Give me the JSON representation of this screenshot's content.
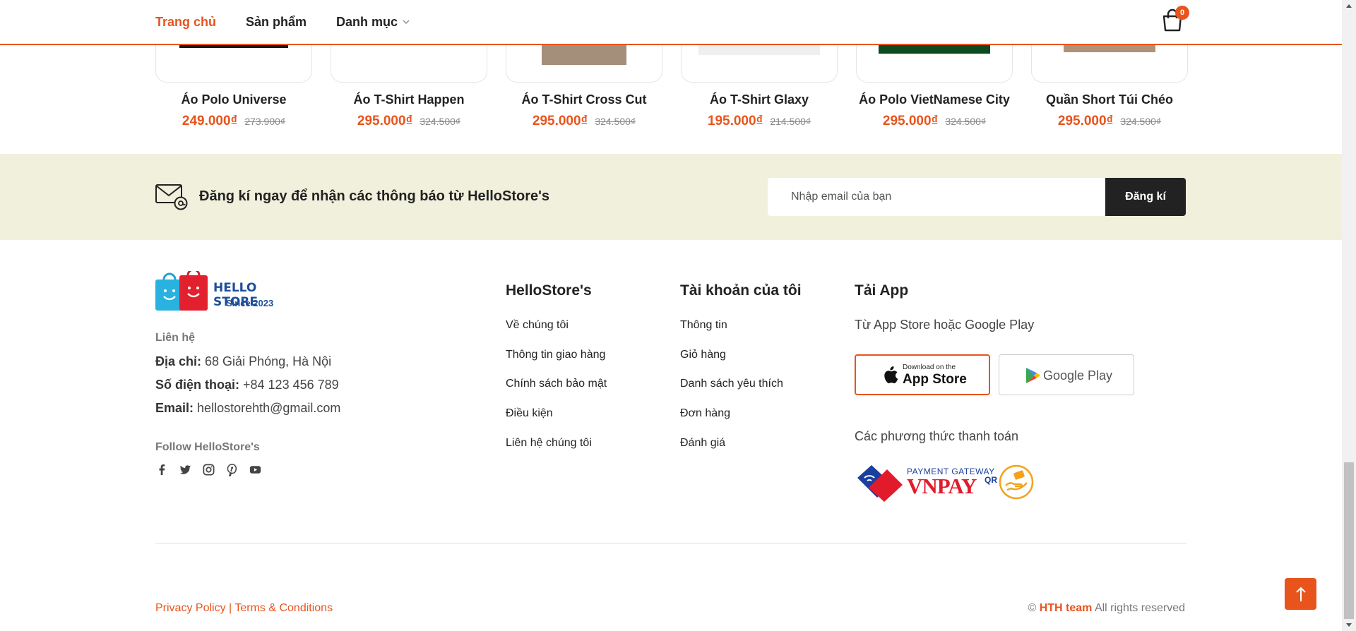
{
  "header": {
    "nav": [
      "Trang chủ",
      "Sản phẩm",
      "Danh mục"
    ],
    "cart_count": "0"
  },
  "products": [
    {
      "name": "Áo Polo Universe",
      "price": "249.000₫",
      "old_price": "273.900₫"
    },
    {
      "name": "Áo T-Shirt Happen",
      "price": "295.000₫",
      "old_price": "324.500₫"
    },
    {
      "name": "Áo T-Shirt Cross Cut",
      "price": "295.000₫",
      "old_price": "324.500₫"
    },
    {
      "name": "Áo T-Shirt Glaxy",
      "price": "195.000₫",
      "old_price": "214.500₫"
    },
    {
      "name": "Áo Polo VietNamese City",
      "price": "295.000₫",
      "old_price": "324.500₫"
    },
    {
      "name": "Quần Short Túi Chéo",
      "price": "295.000₫",
      "old_price": "324.500₫"
    }
  ],
  "newsletter": {
    "text": "Đăng kí ngay để nhận các thông báo từ HelloStore's",
    "placeholder": "Nhập email của bạn",
    "button": "Đăng kí"
  },
  "footer": {
    "logo_line1": "HELLO STORE",
    "logo_line2": "Since 2023",
    "contact_heading": "Liên hệ",
    "address_label": "Địa chỉ:",
    "address": "68 Giải Phóng, Hà Nội",
    "phone_label": "Số điện thoại:",
    "phone": "+84 123 456 789",
    "email_label": "Email:",
    "email": "hellostorehth@gmail.com",
    "follow_heading": "Follow HelloStore's",
    "socials": [
      "facebook-icon",
      "twitter-icon",
      "instagram-icon",
      "pinterest-icon",
      "youtube-icon"
    ],
    "col1_title": "HelloStore's",
    "col1_links": [
      "Về chúng tôi",
      "Thông tin giao hàng",
      "Chính sách bảo mật",
      "Điều kiện",
      "Liên hệ chúng tôi"
    ],
    "col2_title": "Tài khoản của tôi",
    "col2_links": [
      "Thông tin",
      "Giỏ hàng",
      "Danh sách yêu thích",
      "Đơn hàng",
      "Đánh giá"
    ],
    "app_title": "Tải App",
    "app_sub": "Từ App Store hoặc Google Play",
    "apple_small": "Download on the",
    "apple_big": "App Store",
    "google": "Google Play",
    "pay_title": "Các phương thức thanh toán",
    "vnpay_gateway": "PAYMENT GATEWAY",
    "vnpay_name": "VNPAY",
    "vnpay_qr": "QR"
  },
  "bottom": {
    "privacy": "Privacy Policy",
    "sep": " | ",
    "terms": "Terms & Conditions",
    "copy_prefix": "© ",
    "team": "HTH team",
    "copy_suffix": " All rights reserved"
  },
  "colors": {
    "accent": "#e8541c",
    "newsletter_bg": "#f0f0dd",
    "dark": "#222222"
  }
}
